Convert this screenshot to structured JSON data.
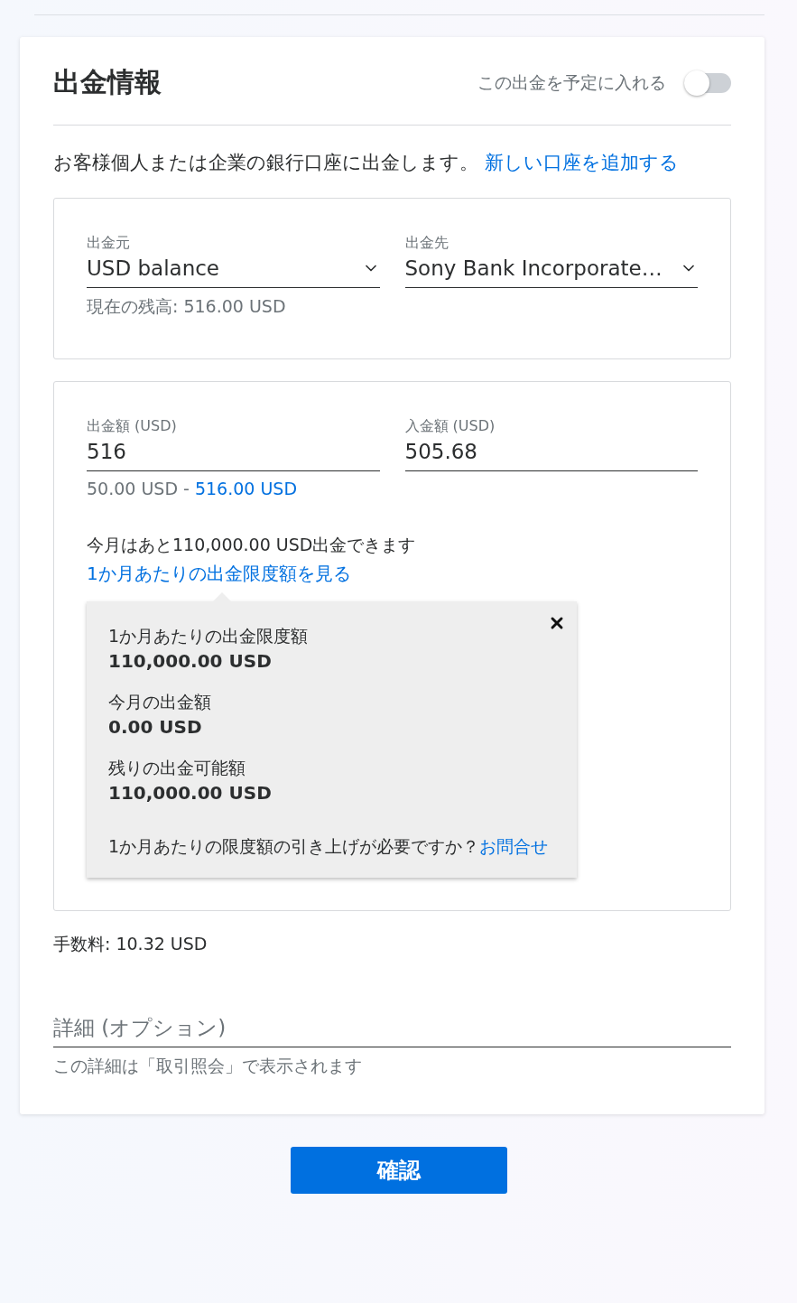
{
  "header": {
    "title": "出金情報",
    "schedule_toggle": {
      "label": "この出金を予定に入れる",
      "on": false
    }
  },
  "intro": {
    "text": "お客様個人または企業の銀行口座に出金します。",
    "link": "新しい口座を追加する"
  },
  "accounts": {
    "fields": [
      {
        "label": "出金元",
        "value": "USD balance"
      },
      {
        "label": "出金先",
        "value": "Sony Bank Incorporate…"
      }
    ],
    "balance_note": "現在の残高: 516.00 USD"
  },
  "amounts": {
    "fields": [
      {
        "label": "出金額 (USD)",
        "value": "516"
      },
      {
        "label": "入金額 (USD)",
        "value": "505.68"
      }
    ],
    "range": {
      "min": "50.00 USD",
      "separator": "-",
      "max": "516.00 USD"
    },
    "remaining_text": "今月はあと110,000.00 USD出金できます",
    "limit_link": "1か月あたりの出金限度額を見る",
    "popover": {
      "items": [
        {
          "label": "1か月あたりの出金限度額",
          "value": "110,000.00 USD"
        },
        {
          "label": "今月の出金額",
          "value": "0.00 USD"
        },
        {
          "label": "残りの出金可能額",
          "value": "110,000.00 USD"
        }
      ],
      "footer_text": "1か月あたりの限度額の引き上げが必要ですか？",
      "footer_link": "お問合せ"
    }
  },
  "fee": "手数料: 10.32 USD",
  "memo": {
    "placeholder": "詳細 (オプション)",
    "hint": "この詳細は「取引照会」で表示されます"
  },
  "confirm_button": "確認"
}
